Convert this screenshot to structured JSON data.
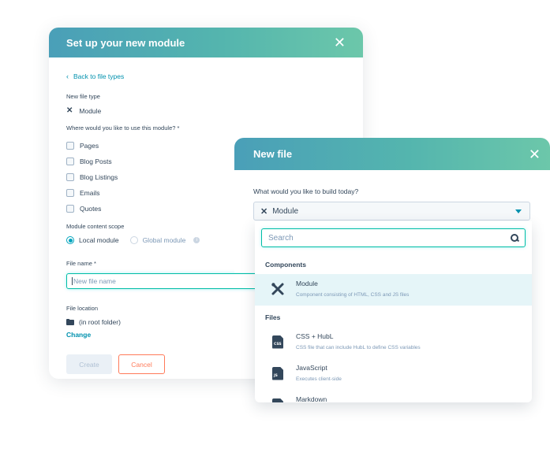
{
  "setup_modal": {
    "title": "Set up your new module",
    "close_icon": "close-icon",
    "back_link": "Back to file types",
    "new_file_type_label": "New file type",
    "file_type_value": "Module",
    "use_question": "Where would you like to use this module? *",
    "use_options": [
      "Pages",
      "Blog Posts",
      "Blog Listings",
      "Emails",
      "Quotes"
    ],
    "scope_label": "Module content scope",
    "scope_local": "Local module",
    "scope_global": "Global module",
    "file_name_label": "File name *",
    "file_name_placeholder": "New file name",
    "file_location_label": "File location",
    "file_location_value": "(in root folder)",
    "change_link": "Change",
    "create_button": "Create",
    "cancel_button": "Cancel"
  },
  "new_file_modal": {
    "title": "New file",
    "question": "What would you like to build today?",
    "selected_value": "Module",
    "search_placeholder": "Search",
    "groups": {
      "components": "Components",
      "files": "Files"
    },
    "options": [
      {
        "name": "Module",
        "desc": "Component consisting of HTML, CSS and JS files",
        "icon": "tools-icon"
      },
      {
        "name": "CSS + HubL",
        "desc": "CSS file that can include HubL to define CSS variables",
        "icon": "css-file-icon"
      },
      {
        "name": "JavaScript",
        "desc": "Executes client-side",
        "icon": "js-file-icon"
      },
      {
        "name": "Markdown",
        "desc": "",
        "icon": "markdown-file-icon"
      }
    ]
  },
  "colors": {
    "header_gradient_start": "#4a9fb8",
    "header_gradient_end": "#6cc7aa",
    "link": "#0091ae",
    "cancel": "#ff7a59",
    "focus": "#00bda5"
  }
}
